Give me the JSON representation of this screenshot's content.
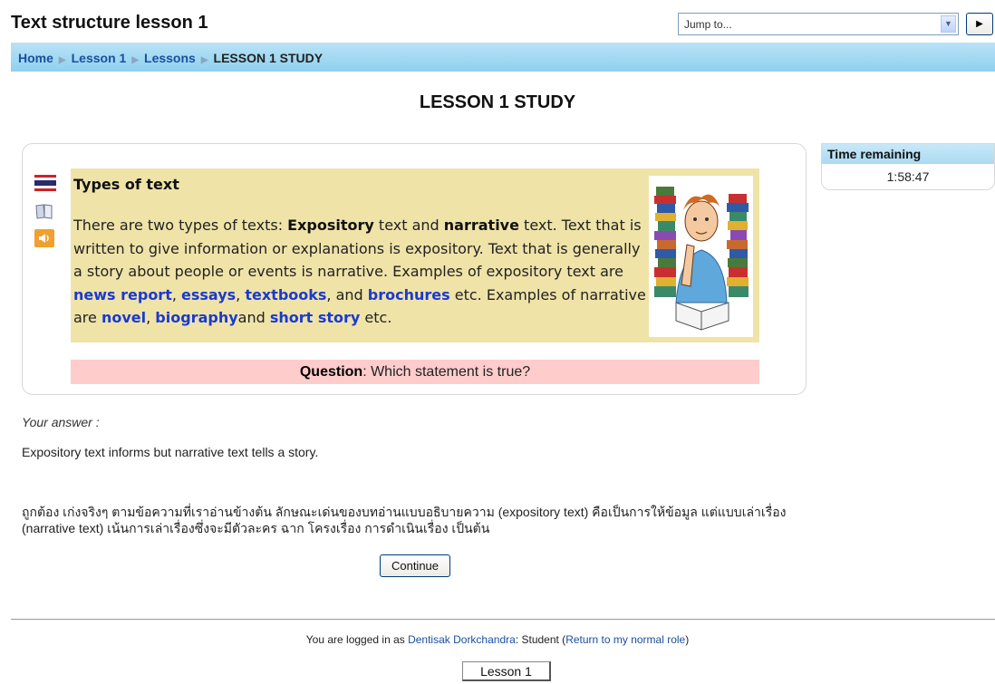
{
  "header": {
    "site_title": "Text structure lesson 1",
    "jump_to": "Jump to...",
    "go_label": "▶"
  },
  "breadcrumb": {
    "items": [
      "Home",
      "Lesson 1",
      "Lessons"
    ],
    "current": "LESSON 1 STUDY"
  },
  "page": {
    "title": "LESSON 1 STUDY"
  },
  "icons": [
    "thai-flag-icon",
    "book-icon",
    "audio-speaker-icon"
  ],
  "content": {
    "title": "Types of text",
    "p1": "There are two types of texts: ",
    "b1": "Expository",
    "p2": " text and ",
    "b2": "narrative",
    "p3": " text. Text that is written to give information or explanations is expository. Text that is generally a story about people or events is narrative. Examples of expository text are ",
    "link1": "news report",
    "c1": ", ",
    "link2": "essays",
    "c2": ", ",
    "link3": "textbooks",
    "c3": ", and ",
    "link4": "brochures",
    "p4": " etc. Examples of narrative are ",
    "link5": "novel",
    "c4": ", ",
    "link6": "biography",
    "c5": "and ",
    "link7": "short story",
    "p5": " etc."
  },
  "question": {
    "label": "Question",
    "text": ": Which statement is true?"
  },
  "timer": {
    "label": "Time remaining",
    "value": "1:58:47"
  },
  "answer": {
    "label": "Your answer :",
    "text": "Expository text informs but narrative text tells a story."
  },
  "feedback": "ถูกต้อง เก่งจริงๆ ตามข้อความที่เราอ่านข้างต้น ลักษณะเด่นของบทอ่านแบบอธิบายความ (expository text) คือเป็นการให้ข้อมูล แต่แบบเล่าเรื่อง (narrative text) เน้นการเล่าเรื่องซึ่งจะมีตัวละคร ฉาก โครงเรื่อง การดำเนินเรื่อง เป็นต้น",
  "continue_label": "Continue",
  "footer": {
    "prefix": "You are logged in as ",
    "user": "Dentisak Dorkchandra",
    "role": ": Student (",
    "return_link": "Return to my normal role",
    "suffix": ")",
    "lesson_button": "Lesson 1"
  },
  "colors": {
    "navbar": "#9fd7f1",
    "content_bg": "#efe3a8",
    "question_bg": "#ffcccc",
    "link": "#1a4fa0"
  }
}
